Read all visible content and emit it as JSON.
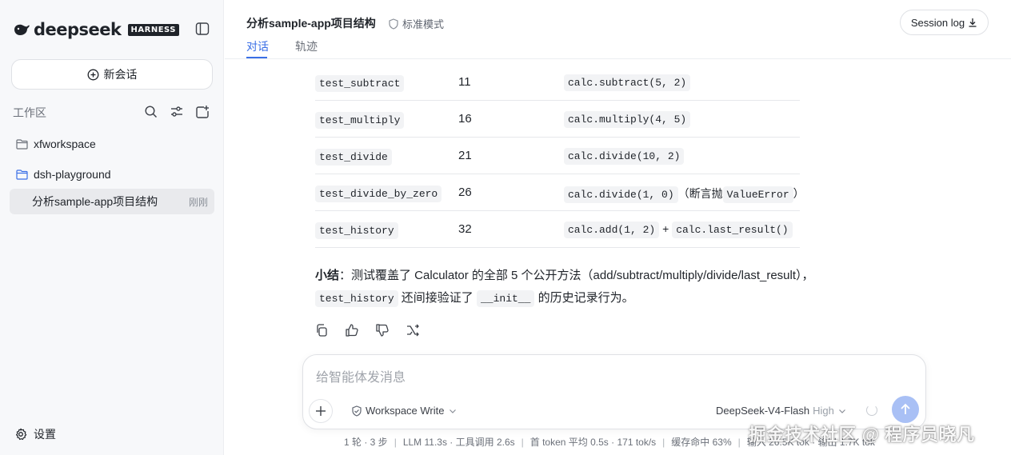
{
  "sidebar": {
    "logo_text": "deepseek",
    "logo_badge": "HARNESS",
    "new_chat_label": "新会话",
    "workspace_label": "工作区",
    "folders": [
      {
        "name": "xfworkspace",
        "icon": "folder-icon"
      },
      {
        "name": "dsh-playground",
        "icon": "folder-open-icon"
      }
    ],
    "active_session": {
      "title": "分析sample-app项目结构",
      "time": "刚刚"
    },
    "settings_label": "设置"
  },
  "header": {
    "title": "分析sample-app项目结构",
    "mode": "标准模式",
    "tabs": [
      "对话",
      "轨迹"
    ],
    "session_log": "Session log"
  },
  "table": {
    "rows": [
      {
        "name": "test_subtract",
        "line": "11",
        "calls": [
          {
            "code": "calc.subtract(5, 2)"
          }
        ]
      },
      {
        "name": "test_multiply",
        "line": "16",
        "calls": [
          {
            "code": "calc.multiply(4, 5)"
          }
        ]
      },
      {
        "name": "test_divide",
        "line": "21",
        "calls": [
          {
            "code": "calc.divide(10, 2)"
          }
        ]
      },
      {
        "name": "test_divide_by_zero",
        "line": "26",
        "calls": [
          {
            "code": "calc.divide(1, 0)"
          },
          {
            "text": "（断言抛"
          },
          {
            "code": "ValueError"
          },
          {
            "text": "）"
          }
        ]
      },
      {
        "name": "test_history",
        "line": "32",
        "calls": [
          {
            "code": "calc.add(1, 2)"
          },
          {
            "text": "+"
          },
          {
            "code": "calc.last_result()"
          }
        ]
      }
    ]
  },
  "summary": {
    "bold": "小结",
    "line1": "：测试覆盖了 Calculator 的全部 5 个公开方法（add/subtract/multiply/divide/last_result），",
    "code1": "test_history",
    "mid": "还间接验证了",
    "code2": "__init__",
    "end": "的历史记录行为。"
  },
  "composer": {
    "placeholder": "给智能体发消息",
    "workspace_mode": "Workspace Write",
    "model": "DeepSeek-V4-Flash",
    "effort": "High"
  },
  "status_bar": {
    "items": [
      "1 轮 · 3 步",
      "LLM 11.3s · 工具调用 2.6s",
      "首 token 平均 0.5s · 171 tok/s",
      "缓存命中 63%",
      "输入 26.5K tok · 输出 1.7K tok"
    ]
  },
  "watermark": "掘金技术社区 @ 程序员晓凡",
  "colors": {
    "accent": "#3a6fe6",
    "send_button": "#a9c0f5",
    "sidebar_bg": "#f7f8fa"
  }
}
